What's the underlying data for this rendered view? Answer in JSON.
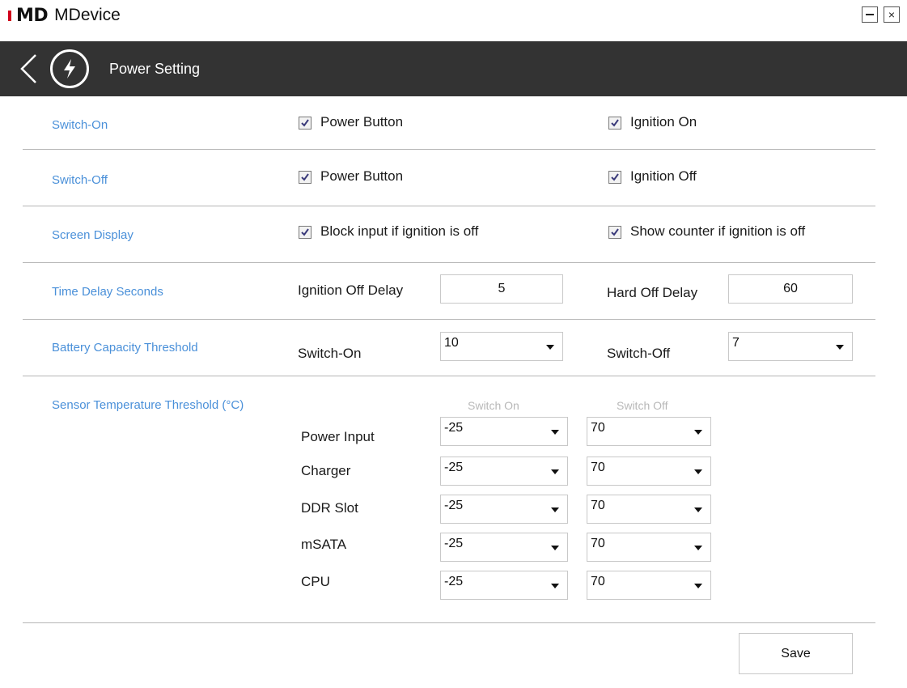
{
  "window": {
    "app_name": "MDevice",
    "logo_text": "MD",
    "close_glyph": "×"
  },
  "header": {
    "title": "Power Setting"
  },
  "colors": {
    "header_bg": "#333333",
    "label_blue": "#4a90d9",
    "logo_red": "#d0021b"
  },
  "switch_on": {
    "label": "Switch-On",
    "option_a": "Power Button",
    "option_a_checked": true,
    "option_b": "Ignition On",
    "option_b_checked": true
  },
  "switch_off": {
    "label": "Switch-Off",
    "option_a": "Power Button",
    "option_a_checked": true,
    "option_b": "Ignition Off",
    "option_b_checked": true
  },
  "screen_display": {
    "label": "Screen Display",
    "option_a": "Block input if ignition is off",
    "option_a_checked": true,
    "option_b": "Show counter if ignition is off",
    "option_b_checked": true
  },
  "time_delay": {
    "label": "Time Delay Seconds",
    "ignition_off_label": "Ignition Off Delay",
    "ignition_off_value": "5",
    "hard_off_label": "Hard Off Delay",
    "hard_off_value": "60"
  },
  "battery": {
    "label": "Battery Capacity Threshold",
    "switch_on_label": "Switch-On",
    "switch_on_value": "10",
    "switch_off_label": "Switch-Off",
    "switch_off_value": "7"
  },
  "sensor": {
    "label": "Sensor Temperature Threshold (°C)",
    "col_on": "Switch On",
    "col_off": "Switch Off",
    "rows": [
      {
        "name": "Power Input",
        "on": "-25",
        "off": "70"
      },
      {
        "name": "Charger",
        "on": "-25",
        "off": "70"
      },
      {
        "name": "DDR Slot",
        "on": "-25",
        "off": "70"
      },
      {
        "name": "mSATA",
        "on": "-25",
        "off": "70"
      },
      {
        "name": "CPU",
        "on": "-25",
        "off": "70"
      }
    ]
  },
  "footer": {
    "save_label": "Save"
  }
}
